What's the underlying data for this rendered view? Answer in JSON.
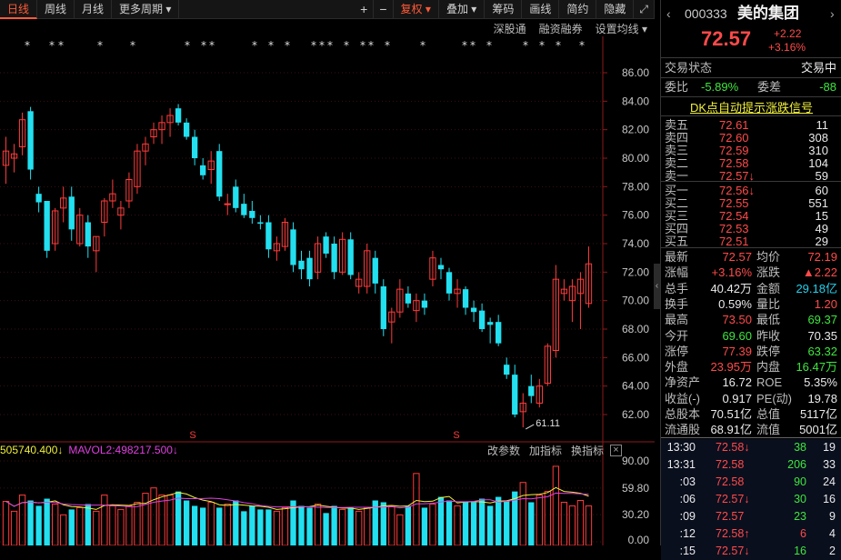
{
  "toolbar": {
    "periods": [
      "日线",
      "周线",
      "月线",
      "更多周期"
    ],
    "plus": "+",
    "minus": "−",
    "adjust": "复权",
    "overlay": "叠加",
    "chips": "筹码",
    "draw": "画线",
    "simple": "简约",
    "hide": "隐藏"
  },
  "subbar": [
    "深股通",
    "融资融券",
    "设置均线"
  ],
  "chart": {
    "y_labels": [
      "86.00",
      "84.00",
      "82.00",
      "80.00",
      "78.00",
      "76.00",
      "74.00",
      "72.00",
      "70.00",
      "68.00",
      "66.00",
      "64.00",
      "62.00"
    ],
    "min_label": "61.11",
    "s_marker": "S",
    "candles": [
      [
        79.5,
        81.5,
        78.2,
        80.5
      ],
      [
        80.0,
        81.0,
        79.0,
        80.3
      ],
      [
        80.8,
        83.2,
        80.2,
        82.7
      ],
      [
        83.3,
        83.6,
        78.5,
        79.2
      ],
      [
        77.5,
        78.0,
        76.2,
        76.9
      ],
      [
        77.0,
        77.0,
        73.0,
        73.5
      ],
      [
        74.0,
        76.5,
        73.5,
        76.3
      ],
      [
        76.5,
        78.0,
        75.5,
        77.2
      ],
      [
        77.3,
        78.0,
        74.2,
        75.0
      ],
      [
        74.0,
        76.5,
        73.8,
        76.0
      ],
      [
        75.5,
        76.0,
        73.0,
        73.8
      ],
      [
        73.5,
        74.5,
        72.0,
        74.5
      ],
      [
        75.5,
        77.2,
        74.5,
        77.0
      ],
      [
        77.0,
        78.5,
        76.5,
        77.5
      ],
      [
        76.0,
        77.0,
        75.0,
        76.5
      ],
      [
        77.0,
        79.0,
        76.5,
        78.5
      ],
      [
        78.0,
        81.0,
        77.5,
        80.5
      ],
      [
        80.5,
        81.5,
        79.5,
        81.0
      ],
      [
        81.5,
        82.5,
        81.0,
        82.0
      ],
      [
        82.0,
        83.0,
        81.0,
        82.5
      ],
      [
        82.5,
        83.5,
        81.5,
        83.0
      ],
      [
        83.5,
        83.8,
        82.3,
        82.5
      ],
      [
        82.5,
        82.8,
        81.3,
        81.5
      ],
      [
        81.5,
        82.0,
        79.5,
        80.0
      ],
      [
        79.5,
        80.0,
        78.5,
        78.8
      ],
      [
        79.2,
        80.5,
        78.2,
        79.8
      ],
      [
        80.5,
        81.0,
        77.0,
        77.3
      ],
      [
        76.8,
        77.5,
        76.0,
        76.8
      ],
      [
        78.0,
        78.5,
        76.2,
        76.5
      ],
      [
        76.8,
        77.5,
        75.8,
        76.0
      ],
      [
        76.3,
        77.0,
        75.4,
        75.8
      ],
      [
        75.5,
        76.0,
        75.0,
        75.4
      ],
      [
        75.5,
        76.0,
        73.0,
        73.6
      ],
      [
        73.5,
        74.5,
        72.8,
        74.0
      ],
      [
        73.8,
        75.8,
        73.5,
        75.5
      ],
      [
        75.0,
        75.5,
        72.0,
        72.5
      ],
      [
        72.8,
        73.5,
        71.5,
        72.2
      ],
      [
        73.0,
        73.5,
        71.0,
        71.5
      ],
      [
        72.0,
        74.5,
        71.5,
        74.0
      ],
      [
        74.5,
        74.8,
        73.0,
        73.3
      ],
      [
        74.0,
        74.5,
        71.5,
        72.0
      ],
      [
        72.0,
        74.8,
        71.8,
        74.3
      ],
      [
        74.3,
        74.8,
        71.5,
        71.8
      ],
      [
        71.0,
        72.0,
        70.5,
        71.5
      ],
      [
        71.0,
        74.0,
        70.5,
        73.5
      ],
      [
        73.0,
        73.5,
        70.5,
        71.2
      ],
      [
        71.0,
        71.5,
        67.5,
        68.0
      ],
      [
        68.5,
        69.5,
        67.0,
        69.2
      ],
      [
        69.2,
        71.5,
        68.8,
        70.8
      ],
      [
        70.5,
        71.0,
        69.5,
        69.8
      ],
      [
        69.3,
        70.5,
        68.5,
        70.0
      ],
      [
        70.0,
        70.5,
        69.0,
        69.5
      ],
      [
        71.5,
        73.5,
        71.0,
        73.0
      ],
      [
        72.5,
        73.0,
        71.5,
        72.2
      ],
      [
        72.0,
        72.3,
        70.0,
        70.5
      ],
      [
        70.5,
        71.5,
        69.5,
        70.8
      ],
      [
        70.8,
        71.0,
        69.0,
        69.5
      ],
      [
        69.5,
        70.0,
        68.5,
        69.2
      ],
      [
        69.3,
        69.8,
        67.8,
        68.0
      ],
      [
        68.5,
        68.8,
        67.0,
        68.3
      ],
      [
        68.5,
        69.0,
        66.8,
        67.0
      ],
      [
        65.5,
        66.0,
        64.5,
        64.8
      ],
      [
        64.8,
        65.5,
        61.8,
        62.0
      ],
      [
        62.2,
        63.5,
        61.1,
        62.8
      ],
      [
        64.0,
        64.8,
        62.8,
        63.3
      ],
      [
        62.8,
        64.5,
        62.5,
        64.0
      ],
      [
        64.2,
        67.0,
        64.0,
        66.8
      ],
      [
        66.5,
        72.5,
        66.0,
        71.5
      ],
      [
        70.5,
        71.5,
        70.0,
        70.8
      ],
      [
        70.0,
        71.5,
        68.5,
        71.0
      ],
      [
        70.5,
        72.0,
        68.0,
        71.5
      ],
      [
        69.8,
        73.8,
        69.5,
        72.58
      ]
    ],
    "volume": {
      "ma_text": "505740.400",
      "ma2_text": "MAVOL2:498217.500",
      "y_labels": [
        "90.00",
        "59.80",
        "30.20",
        "0.00"
      ],
      "bars": [
        45,
        34,
        52,
        46,
        40,
        48,
        42,
        30,
        36,
        38,
        42,
        34,
        52,
        40,
        36,
        40,
        44,
        54,
        60,
        52,
        52,
        56,
        46,
        40,
        38,
        44,
        38,
        42,
        46,
        34,
        40,
        36,
        36,
        34,
        38,
        46,
        40,
        38,
        42,
        32,
        40,
        36,
        38,
        34,
        38,
        46,
        44,
        40,
        30,
        40,
        76,
        38,
        42,
        50,
        46,
        40,
        44,
        44,
        48,
        40,
        50,
        46,
        56,
        66,
        44,
        52,
        56,
        84,
        44,
        40,
        46,
        40
      ],
      "tools": [
        "改参数",
        "加指标",
        "换指标"
      ],
      "close": "×"
    }
  },
  "quote": {
    "code": "000333",
    "name": "美的集团",
    "price": "72.57",
    "chg": "+2.22",
    "chg_pct": "+3.16%",
    "status_label": "交易状态",
    "status_value": "交易中",
    "wb_label": "委比",
    "wb_value": "-5.89%",
    "wc_label": "委差",
    "wc_value": "-88",
    "dk_link": "DK点自动提示涨跌信号",
    "asks": [
      {
        "l": "卖五",
        "p": "72.61",
        "v": "11"
      },
      {
        "l": "卖四",
        "p": "72.60",
        "v": "308"
      },
      {
        "l": "卖三",
        "p": "72.59",
        "v": "310"
      },
      {
        "l": "卖二",
        "p": "72.58",
        "v": "104"
      },
      {
        "l": "卖一",
        "p": "72.57↓",
        "v": "59"
      }
    ],
    "bids": [
      {
        "l": "买一",
        "p": "72.56↓",
        "v": "60"
      },
      {
        "l": "买二",
        "p": "72.55",
        "v": "551"
      },
      {
        "l": "买三",
        "p": "72.54",
        "v": "15"
      },
      {
        "l": "买四",
        "p": "72.53",
        "v": "49"
      },
      {
        "l": "买五",
        "p": "72.51",
        "v": "29"
      }
    ],
    "stats": [
      [
        "最新",
        "72.57",
        "red",
        "均价",
        "72.19",
        "red"
      ],
      [
        "涨幅",
        "+3.16%",
        "red",
        "涨跌",
        "▲2.22",
        "red"
      ],
      [
        "总手",
        "40.42万",
        "white",
        "金额",
        "29.18亿",
        "cyan"
      ],
      [
        "换手",
        "0.59%",
        "white",
        "量比",
        "1.20",
        "red"
      ],
      [
        "最高",
        "73.50",
        "red",
        "最低",
        "69.37",
        "green"
      ],
      [
        "今开",
        "69.60",
        "green",
        "昨收",
        "70.35",
        "white"
      ],
      [
        "涨停",
        "77.39",
        "red",
        "跌停",
        "63.32",
        "green"
      ],
      [
        "外盘",
        "23.95万",
        "red",
        "内盘",
        "16.47万",
        "green"
      ],
      [
        "净资产",
        "16.72",
        "white",
        "ROE",
        "5.35%",
        "white"
      ],
      [
        "收益(-)",
        "0.917",
        "white",
        "PE(动)",
        "19.78",
        "white"
      ],
      [
        "总股本",
        "70.51亿",
        "white",
        "总值",
        "5117亿",
        "white"
      ],
      [
        "流通股",
        "68.91亿",
        "white",
        "流值",
        "5001亿",
        "white"
      ]
    ],
    "ticks": [
      {
        "t": "13:30",
        "p": "72.58↓",
        "v": "38",
        "n": "19"
      },
      {
        "t": "13:31",
        "p": "72.58",
        "v": "206",
        "n": "33"
      },
      {
        "t": ":03",
        "p": "72.58",
        "v": "90",
        "n": "24"
      },
      {
        "t": ":06",
        "p": "72.57↓",
        "v": "30",
        "n": "16"
      },
      {
        "t": ":09",
        "p": "72.57",
        "v": "23",
        "n": "9"
      },
      {
        "t": ":12",
        "p": "72.58↑",
        "v": "6",
        "n": "4"
      },
      {
        "t": ":15",
        "p": "72.57↓",
        "v": "16",
        "n": "2"
      }
    ]
  }
}
